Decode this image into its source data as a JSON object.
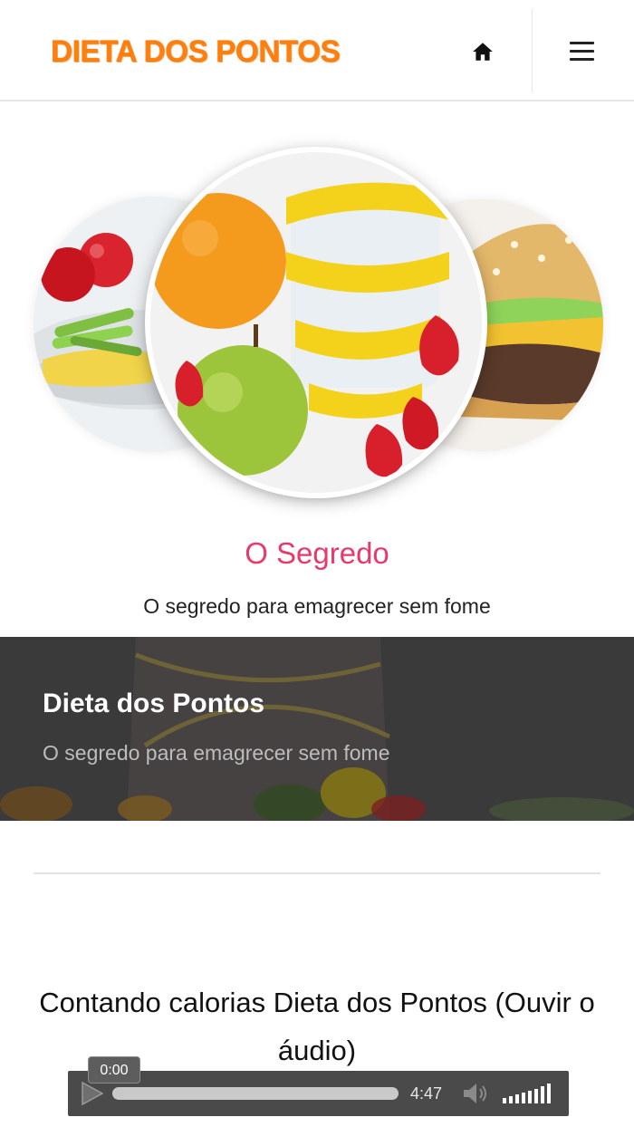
{
  "header": {
    "logo_text": "DIETA DOS PONTOS",
    "home_icon": "home-icon",
    "menu_icon": "hamburger-menu-icon"
  },
  "hero": {
    "left_image": "fruit-and-scale",
    "center_image": "fruit-and-measuring-tape",
    "right_image": "hamburger"
  },
  "section": {
    "title": "O Segredo",
    "subtitle": "O segredo para emagrecer sem fome"
  },
  "banner": {
    "title": "Dieta dos Pontos",
    "subtitle": "O segredo para emagrecer sem fome"
  },
  "article": {
    "title": "Contando calorias Dieta dos Pontos (Ouvir o áudio)"
  },
  "player": {
    "current_time": "0:00",
    "duration": "4:47",
    "progress": 0
  },
  "colors": {
    "logo": "#ff7f0e",
    "section_title": "#e63b6a",
    "banner_bg": "#3b3b3b",
    "player_bg": "#4a4a4a"
  }
}
